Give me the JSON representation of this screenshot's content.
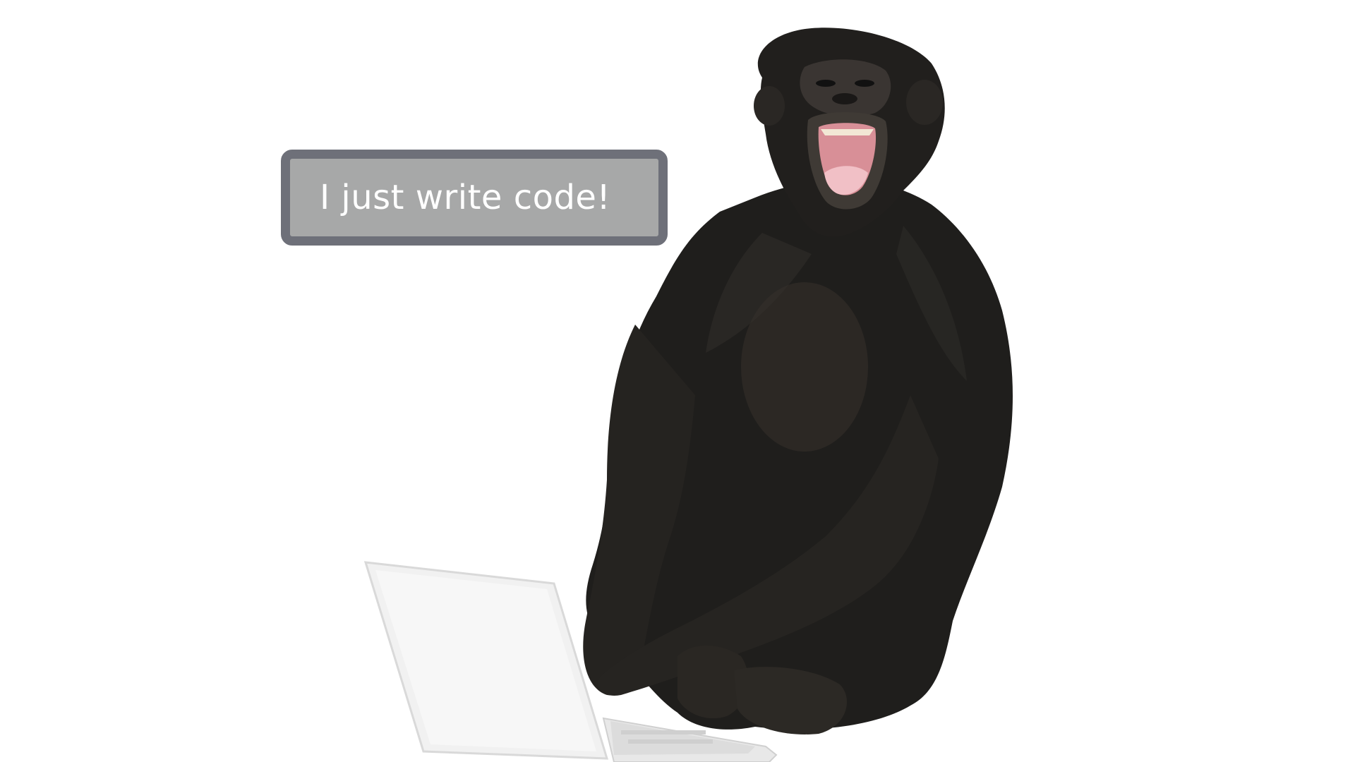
{
  "speech_bubble": {
    "text": "I just write code!",
    "fill_color": "#a7a8a8",
    "border_color": "#6e7079",
    "text_color": "#ffffff"
  },
  "illustration": {
    "subject_icon": "bonobo-laughing",
    "device_icon": "laptop-white",
    "fur_color": "#1f1e1c",
    "mouth_color": "#d88f97",
    "laptop_color": "#f1f1f1",
    "background_color": "#ffffff"
  }
}
